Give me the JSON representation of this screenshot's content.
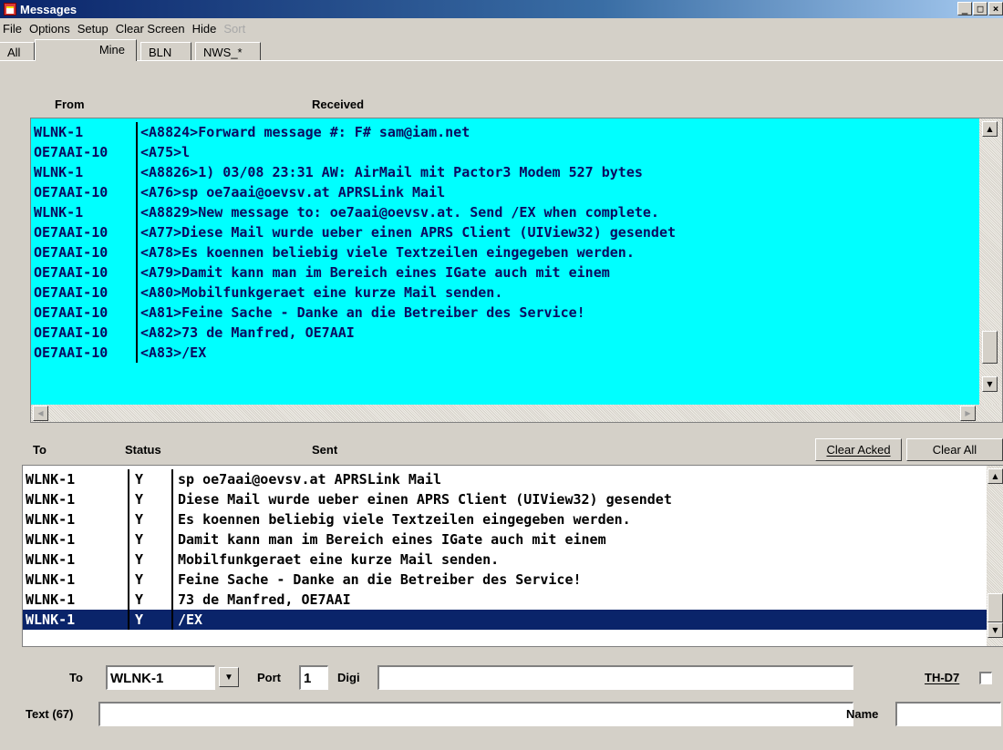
{
  "window": {
    "title": "Messages"
  },
  "menu": [
    "File",
    "Options",
    "Setup",
    "Clear Screen",
    "Hide",
    "Sort"
  ],
  "tabs": [
    "All",
    "Mine",
    "BLN",
    "NWS_*"
  ],
  "received": {
    "col_from": "From",
    "col_received": "Received",
    "rows": [
      {
        "from": "WLNK-1",
        "msg": "<A8824>Forward message #: F# sam@iam.net"
      },
      {
        "from": "OE7AAI-10",
        "msg": "<A75>l"
      },
      {
        "from": "WLNK-1",
        "msg": "<A8826>1) 03/08 23:31 AW: AirMail mit Pactor3 Modem 527 bytes"
      },
      {
        "from": "OE7AAI-10",
        "msg": "<A76>sp oe7aai@oevsv.at APRSLink Mail"
      },
      {
        "from": "WLNK-1",
        "msg": "<A8829>New message to: oe7aai@oevsv.at. Send /EX when complete."
      },
      {
        "from": "OE7AAI-10",
        "msg": "<A77>Diese Mail wurde ueber einen APRS Client (UIView32) gesendet"
      },
      {
        "from": "OE7AAI-10",
        "msg": "<A78>Es koennen beliebig viele Textzeilen eingegeben werden."
      },
      {
        "from": "OE7AAI-10",
        "msg": "<A79>Damit kann man im Bereich eines IGate auch mit einem"
      },
      {
        "from": "OE7AAI-10",
        "msg": "<A80>Mobilfunkgeraet eine kurze Mail senden."
      },
      {
        "from": "OE7AAI-10",
        "msg": "<A81>Feine Sache - Danke an die Betreiber des Service!"
      },
      {
        "from": "OE7AAI-10",
        "msg": "<A82>73 de Manfred, OE7AAI"
      },
      {
        "from": "OE7AAI-10",
        "msg": "<A83>/EX"
      }
    ]
  },
  "sent": {
    "col_to": "To",
    "col_status": "Status",
    "col_sent": "Sent",
    "clear_acked": "Clear Acked",
    "clear_all": "Clear All",
    "rows": [
      {
        "to": "WLNK-1",
        "status": "Y",
        "msg": "sp oe7aai@oevsv.at APRSLink Mail"
      },
      {
        "to": "WLNK-1",
        "status": "Y",
        "msg": "Diese Mail wurde ueber einen APRS Client (UIView32) gesendet"
      },
      {
        "to": "WLNK-1",
        "status": "Y",
        "msg": "Es koennen beliebig viele Textzeilen eingegeben werden."
      },
      {
        "to": "WLNK-1",
        "status": "Y",
        "msg": "Damit kann man im Bereich eines IGate auch mit einem"
      },
      {
        "to": "WLNK-1",
        "status": "Y",
        "msg": "Mobilfunkgeraet eine kurze Mail senden."
      },
      {
        "to": "WLNK-1",
        "status": "Y",
        "msg": "Feine Sache - Danke an die Betreiber des Service!"
      },
      {
        "to": "WLNK-1",
        "status": "Y",
        "msg": "73 de Manfred, OE7AAI"
      },
      {
        "to": "WLNK-1",
        "status": "Y",
        "msg": "/EX"
      }
    ]
  },
  "form": {
    "to_label": "To",
    "to_value": "WLNK-1",
    "port_label": "Port",
    "port_value": "1",
    "digi_label": "Digi",
    "digi_value": "",
    "th_d7_label": "TH-D7",
    "text_label": "Text (67)",
    "text_value": "",
    "name_label": "Name",
    "name_value": ""
  },
  "colors": {
    "received_bg": "#00ffff",
    "selection": "#0a246a",
    "titlebar": "#0a246a"
  }
}
